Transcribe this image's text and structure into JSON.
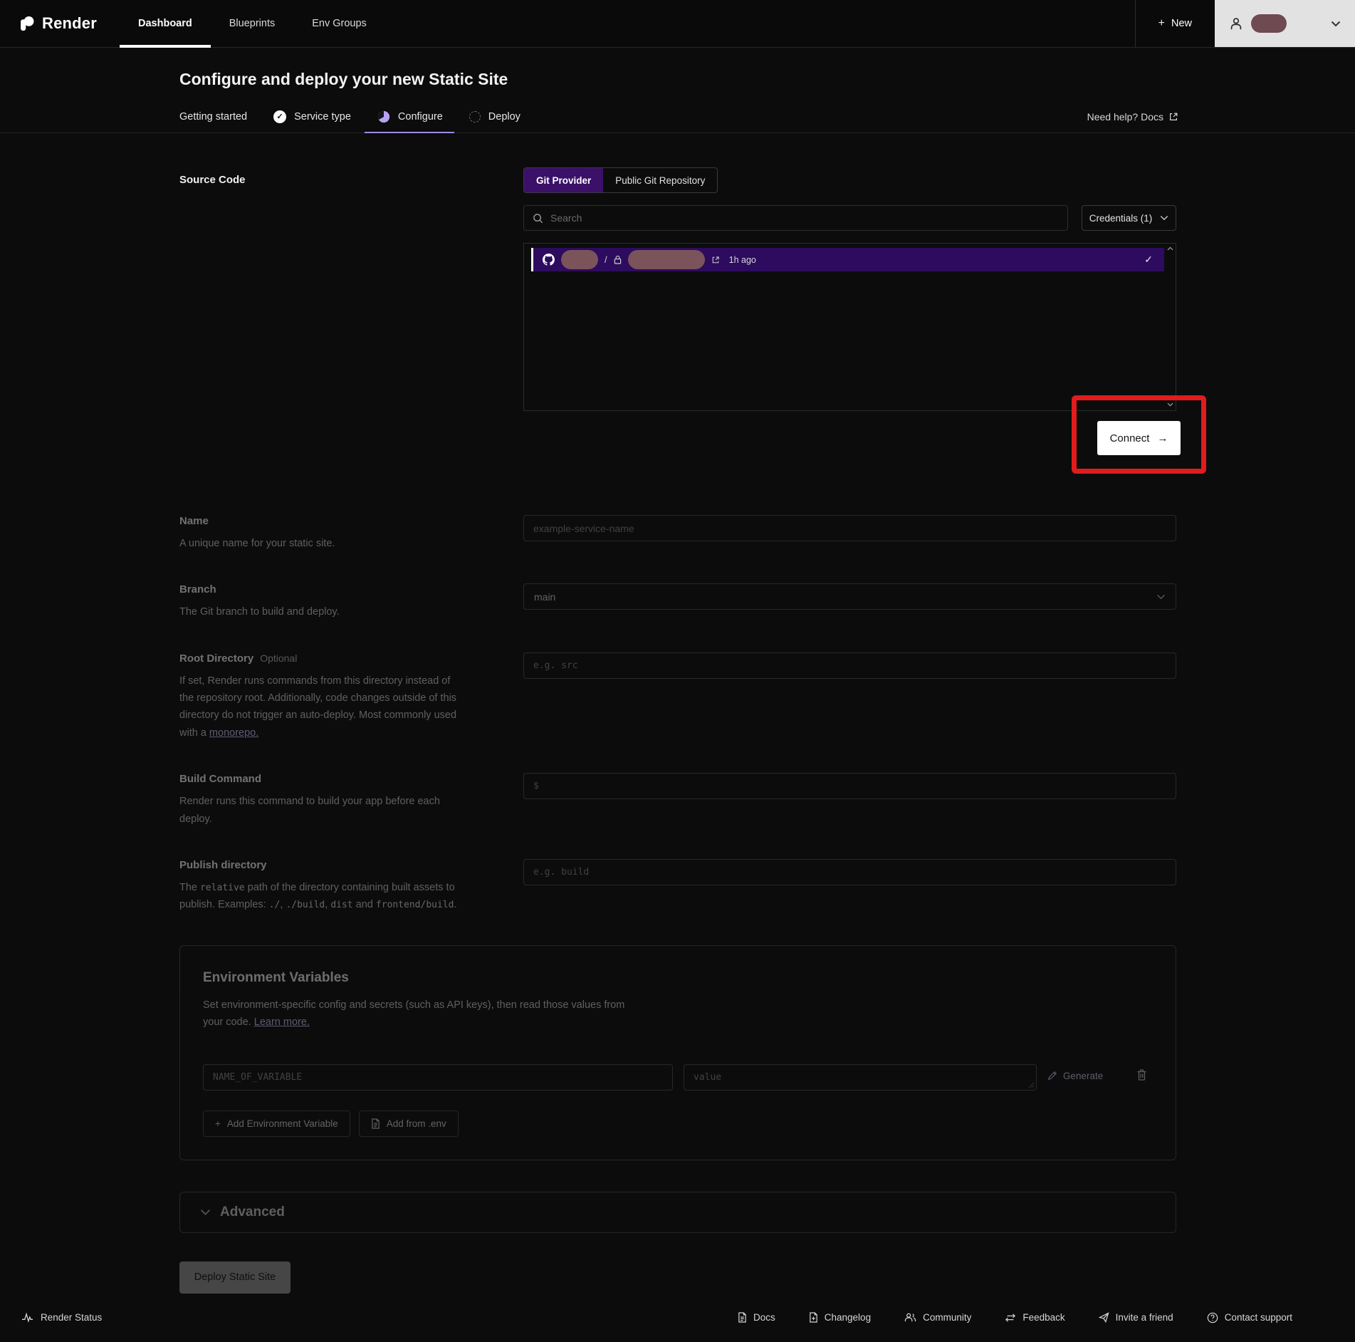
{
  "header": {
    "brand": "Render",
    "nav": [
      {
        "label": "Dashboard",
        "active": true
      },
      {
        "label": "Blueprints",
        "active": false
      },
      {
        "label": "Env Groups",
        "active": false
      }
    ],
    "new_button": "New"
  },
  "page": {
    "title": "Configure and deploy your new Static Site",
    "steps": [
      {
        "label": "Getting started",
        "state": "plain"
      },
      {
        "label": "Service type",
        "state": "done"
      },
      {
        "label": "Configure",
        "state": "active"
      },
      {
        "label": "Deploy",
        "state": "pending"
      }
    ],
    "help_text": "Need help? Docs"
  },
  "source": {
    "label": "Source Code",
    "tabs": [
      {
        "label": "Git Provider",
        "active": true
      },
      {
        "label": "Public Git Repository",
        "active": false
      }
    ],
    "search_placeholder": "Search",
    "credentials_label": "Credentials (1)",
    "repo": {
      "separator": "/",
      "time": "1h ago"
    },
    "connect_label": "Connect"
  },
  "fields": {
    "name": {
      "label": "Name",
      "desc": "A unique name for your static site.",
      "placeholder": "example-service-name"
    },
    "branch": {
      "label": "Branch",
      "desc": "The Git branch to build and deploy.",
      "value": "main"
    },
    "root": {
      "label": "Root Directory",
      "optional": "Optional",
      "desc": "If set, Render runs commands from this directory instead of the repository root. Additionally, code changes outside of this directory do not trigger an auto-deploy. Most commonly used with a ",
      "link": "monorepo.",
      "placeholder": "e.g. src"
    },
    "build": {
      "label": "Build Command",
      "desc": "Render runs this command to build your app before each deploy.",
      "prefix": "$"
    },
    "publish": {
      "label": "Publish directory",
      "t1": "The ",
      "c1": "relative",
      "t2": " path of the directory containing built assets to publish. Examples: ",
      "c2": "./",
      "t3": ", ",
      "c3": "./build",
      "t4": ", ",
      "c4": "dist",
      "t5": " and ",
      "c5": "frontend/build",
      "t6": ".",
      "placeholder": "e.g. build"
    }
  },
  "env": {
    "title": "Environment Variables",
    "desc": "Set environment-specific config and secrets (such as API keys), then read those values from your code. ",
    "link": "Learn more.",
    "name_placeholder": "NAME_OF_VARIABLE",
    "value_placeholder": "value",
    "generate_label": "Generate",
    "add_variable_label": "Add Environment Variable",
    "add_env_label": "Add from .env"
  },
  "advanced_label": "Advanced",
  "deploy_label": "Deploy Static Site",
  "footer": {
    "status": "Render Status",
    "links": [
      {
        "label": "Docs"
      },
      {
        "label": "Changelog"
      },
      {
        "label": "Community"
      },
      {
        "label": "Feedback"
      },
      {
        "label": "Invite a friend"
      },
      {
        "label": "Contact support"
      }
    ]
  },
  "icons": {
    "check": "✓",
    "plus": "+",
    "arrow_right": "→",
    "dollar": "$"
  },
  "colors": {
    "accent_purple": "#a18ae6",
    "tab_purple": "#3b1068",
    "row_purple": "#2d0b5f",
    "annotation_red": "#e01c1c",
    "redaction": "#7a545a",
    "avatar_pill": "#6f4a51"
  }
}
